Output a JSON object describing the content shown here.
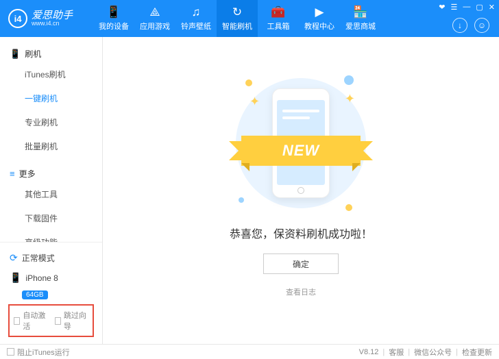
{
  "app": {
    "name": "爱思助手",
    "url": "www.i4.cn",
    "logo_text": "i4"
  },
  "window_controls": [
    "❤",
    "☰",
    "—",
    "▢",
    "✕"
  ],
  "nav": [
    {
      "icon": "📱",
      "label": "我的设备"
    },
    {
      "icon": "⟁",
      "label": "应用游戏"
    },
    {
      "icon": "♫",
      "label": "铃声壁纸"
    },
    {
      "icon": "↻",
      "label": "智能刷机",
      "active": true
    },
    {
      "icon": "🧰",
      "label": "工具箱"
    },
    {
      "icon": "▶",
      "label": "教程中心"
    },
    {
      "icon": "🏪",
      "label": "爱思商城"
    }
  ],
  "top_right": {
    "download": "↓",
    "user": "☺"
  },
  "sidebar": {
    "groups": [
      {
        "icon": "📱",
        "title": "刷机",
        "items": [
          "iTunes刷机",
          "一键刷机",
          "专业刷机",
          "批量刷机"
        ],
        "active_index": 1
      },
      {
        "icon": "≡",
        "title": "更多",
        "items": [
          "其他工具",
          "下载固件",
          "高级功能"
        ]
      }
    ],
    "mode": {
      "icon": "⟳",
      "label": "正常模式"
    },
    "device": {
      "icon": "📱",
      "name": "iPhone 8",
      "storage": "64GB"
    },
    "checkboxes": [
      "自动激活",
      "跳过向导"
    ]
  },
  "main": {
    "ribbon": "NEW",
    "success": "恭喜您，保资料刷机成功啦！",
    "ok": "确定",
    "log_link": "查看日志"
  },
  "footer": {
    "block_itunes": "阻止iTunes运行",
    "version": "V8.12",
    "links": [
      "客服",
      "微信公众号",
      "检查更新"
    ]
  }
}
